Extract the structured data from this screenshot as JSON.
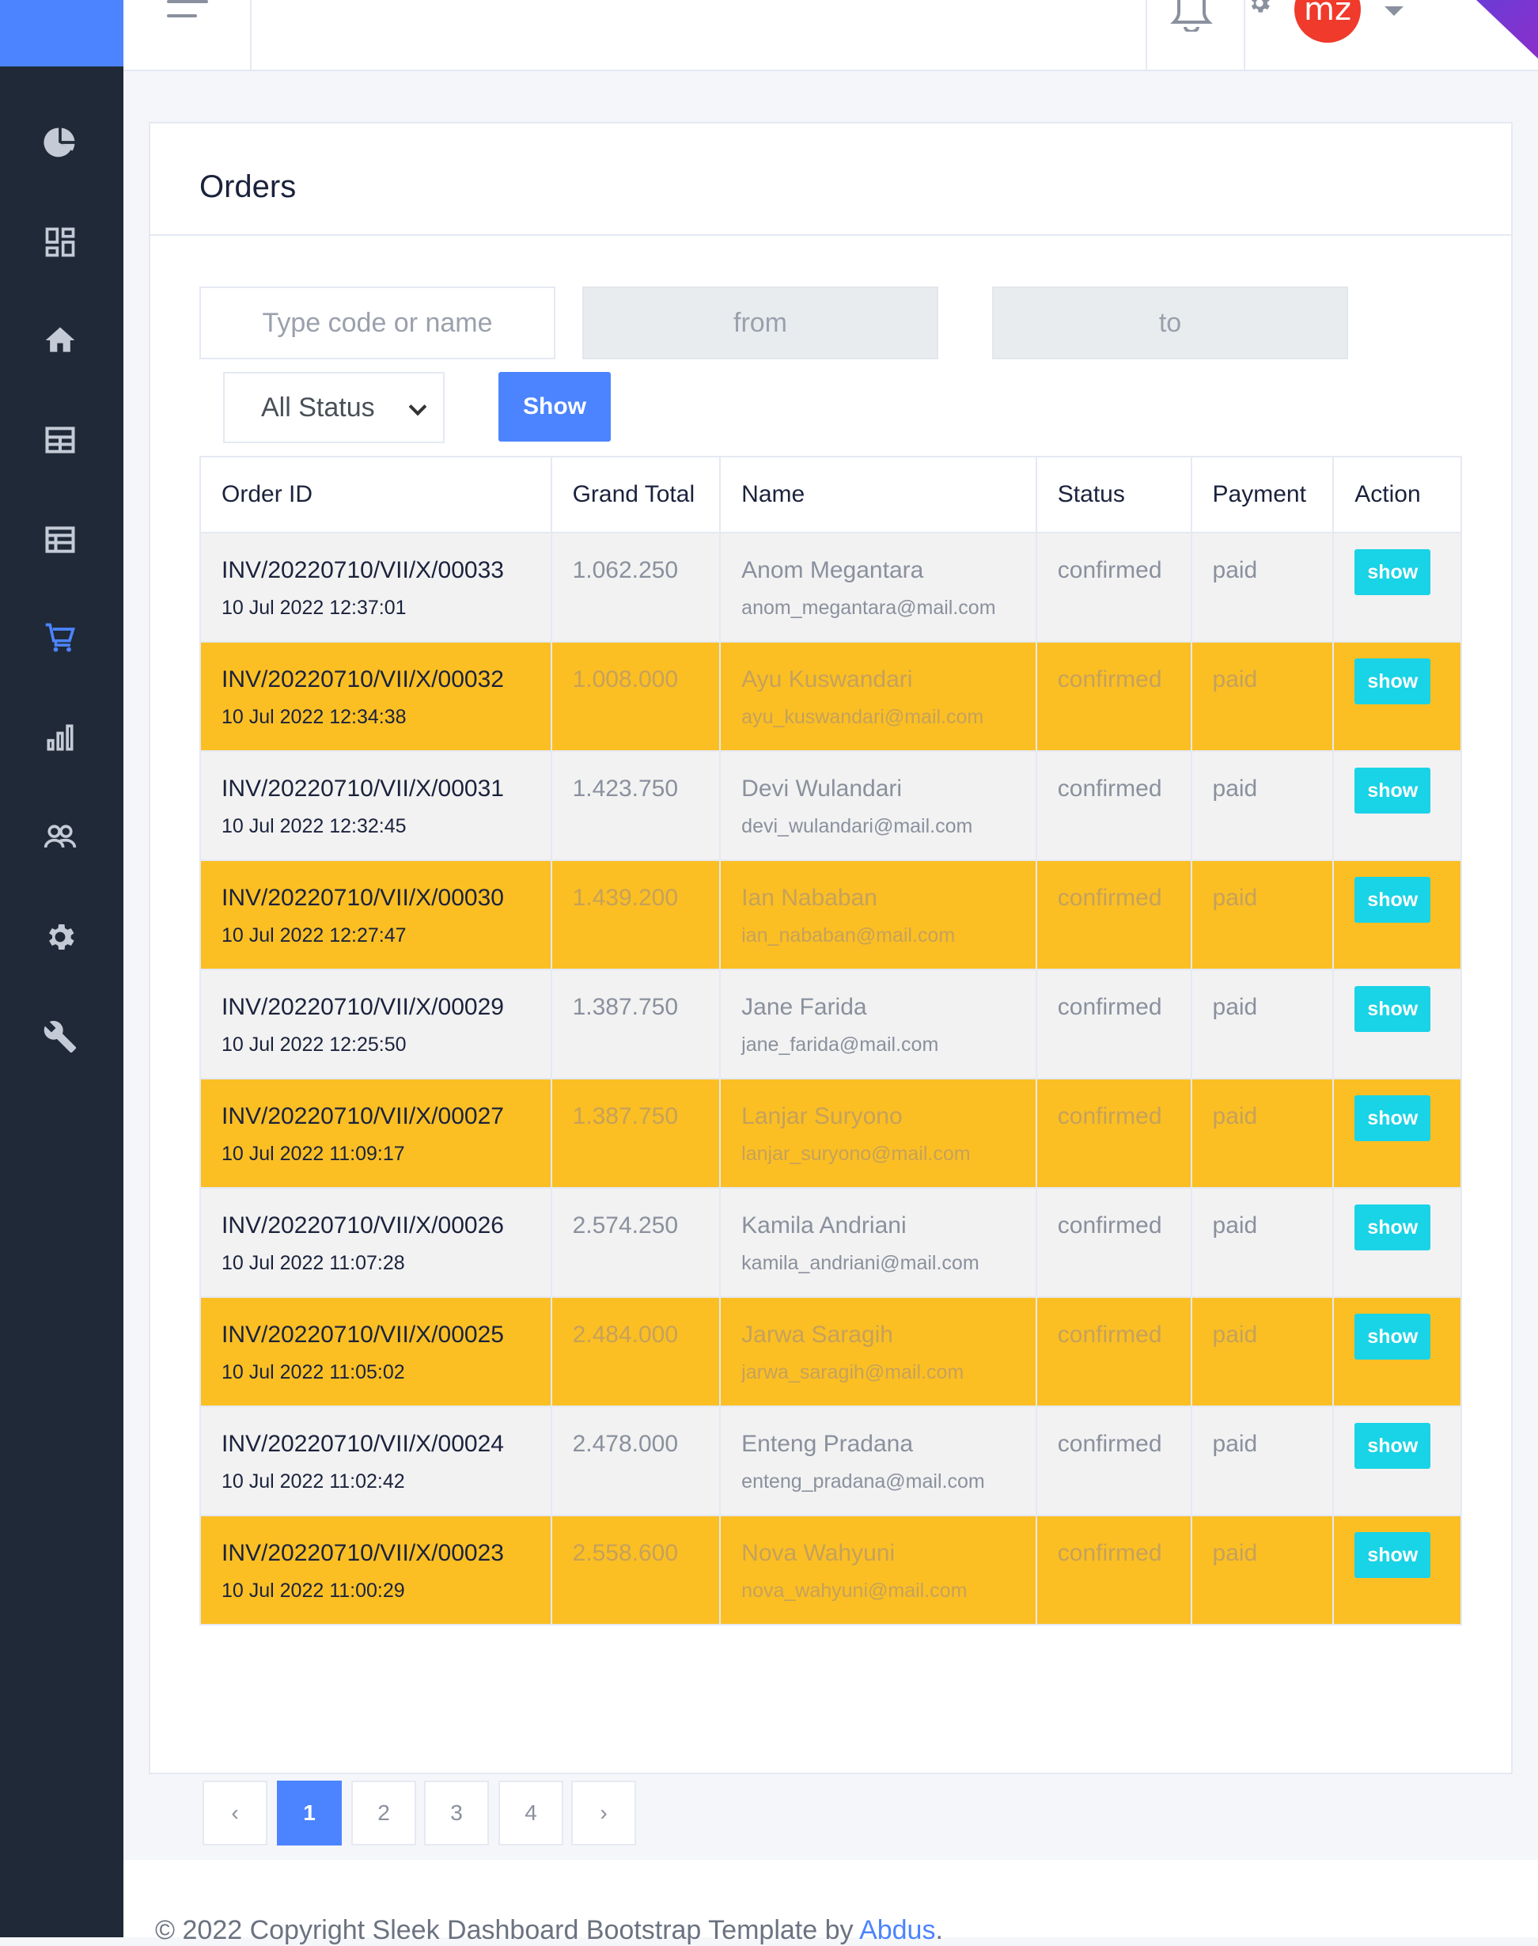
{
  "sidebar": {
    "icons": [
      "pie-chart-icon",
      "dashboard-icon",
      "home-icon",
      "table-icon",
      "calendar-icon",
      "cart-icon",
      "bar-chart-icon",
      "users-icon",
      "settings-icon",
      "wrench-icon"
    ],
    "active": "cart-icon",
    "colors": {
      "background": "#1f2937",
      "brand": "#4c84ff",
      "active": "#4c84ff",
      "icon": "#c5cbd6"
    }
  },
  "header": {
    "avatar_initials": "mz"
  },
  "orders": {
    "title": "Orders",
    "filters": {
      "search_placeholder": "Type code or name",
      "from_placeholder": "from",
      "to_placeholder": "to",
      "status_selected": "All Status",
      "show_label": "Show"
    },
    "columns": [
      "Order ID",
      "Grand Total",
      "Name",
      "Status",
      "Payment",
      "Action"
    ],
    "rows": [
      {
        "id": "INV/20220710/VII/X/00033",
        "date": "10 Jul 2022 12:37:01",
        "total": "1.062.250",
        "name": "Anom Megantara",
        "email": "anom_megantara@mail.com",
        "status": "confirmed",
        "payment": "paid",
        "action": "show"
      },
      {
        "id": "INV/20220710/VII/X/00032",
        "date": "10 Jul 2022 12:34:38",
        "total": "1.008.000",
        "name": "Ayu Kuswandari",
        "email": "ayu_kuswandari@mail.com",
        "status": "confirmed",
        "payment": "paid",
        "action": "show"
      },
      {
        "id": "INV/20220710/VII/X/00031",
        "date": "10 Jul 2022 12:32:45",
        "total": "1.423.750",
        "name": "Devi Wulandari",
        "email": "devi_wulandari@mail.com",
        "status": "confirmed",
        "payment": "paid",
        "action": "show"
      },
      {
        "id": "INV/20220710/VII/X/00030",
        "date": "10 Jul 2022 12:27:47",
        "total": "1.439.200",
        "name": "Ian Nababan",
        "email": "ian_nababan@mail.com",
        "status": "confirmed",
        "payment": "paid",
        "action": "show"
      },
      {
        "id": "INV/20220710/VII/X/00029",
        "date": "10 Jul 2022 12:25:50",
        "total": "1.387.750",
        "name": "Jane Farida",
        "email": "jane_farida@mail.com",
        "status": "confirmed",
        "payment": "paid",
        "action": "show"
      },
      {
        "id": "INV/20220710/VII/X/00027",
        "date": "10 Jul 2022 11:09:17",
        "total": "1.387.750",
        "name": "Lanjar Suryono",
        "email": "lanjar_suryono@mail.com",
        "status": "confirmed",
        "payment": "paid",
        "action": "show"
      },
      {
        "id": "INV/20220710/VII/X/00026",
        "date": "10 Jul 2022 11:07:28",
        "total": "2.574.250",
        "name": "Kamila Andriani",
        "email": "kamila_andriani@mail.com",
        "status": "confirmed",
        "payment": "paid",
        "action": "show"
      },
      {
        "id": "INV/20220710/VII/X/00025",
        "date": "10 Jul 2022 11:05:02",
        "total": "2.484.000",
        "name": "Jarwa Saragih",
        "email": "jarwa_saragih@mail.com",
        "status": "confirmed",
        "payment": "paid",
        "action": "show"
      },
      {
        "id": "INV/20220710/VII/X/00024",
        "date": "10 Jul 2022 11:02:42",
        "total": "2.478.000",
        "name": "Enteng Pradana",
        "email": "enteng_pradana@mail.com",
        "status": "confirmed",
        "payment": "paid",
        "action": "show"
      },
      {
        "id": "INV/20220710/VII/X/00023",
        "date": "10 Jul 2022 11:00:29",
        "total": "2.558.600",
        "name": "Nova Wahyuni",
        "email": "nova_wahyuni@mail.com",
        "status": "confirmed",
        "payment": "paid",
        "action": "show"
      }
    ],
    "row_colors": {
      "odd": "#f2f2f2",
      "even": "#fbbf24",
      "action_button": "#19d3e6"
    }
  },
  "pagination": {
    "prev": "‹",
    "pages": [
      "1",
      "2",
      "3",
      "4"
    ],
    "active": "1",
    "next": "›"
  },
  "footer": {
    "text": "© 2022 Copyright Sleek Dashboard Bootstrap Template by ",
    "link": "Abdus",
    "suffix": "."
  }
}
